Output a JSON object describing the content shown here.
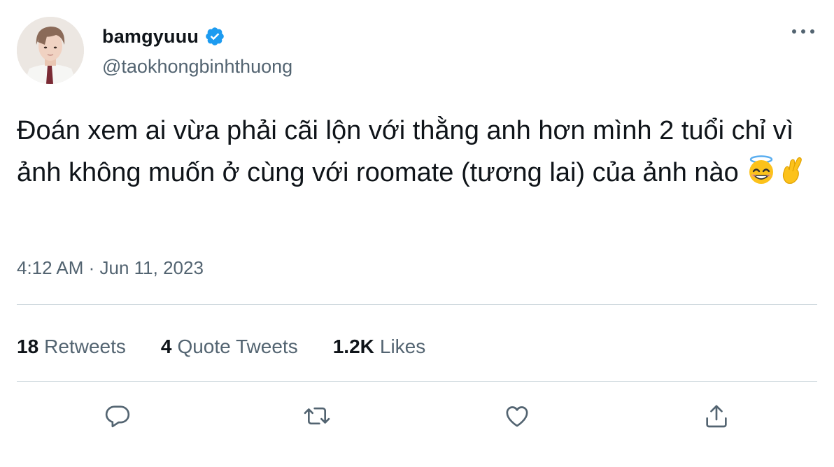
{
  "user": {
    "display_name": "bamgyuuu",
    "handle": "@taokhongbinhthuong",
    "verified": true
  },
  "tweet": {
    "text": "Đoán xem ai vừa phải cãi lộn với thằng anh hơn mình 2 tuổi chỉ vì ảnh không muốn ở cùng với roomate (tương lai) của ảnh nào",
    "emojis": [
      "smiling-face-with-halo",
      "crossed-fingers"
    ],
    "timestamp": "4:12 AM · Jun 11, 2023"
  },
  "stats": {
    "retweets_count": "18",
    "retweets_label": "Retweets",
    "quotes_count": "4",
    "quotes_label": "Quote Tweets",
    "likes_count": "1.2K",
    "likes_label": "Likes"
  },
  "colors": {
    "text_primary": "#0f1419",
    "text_secondary": "#536471",
    "verified_blue": "#1d9bf0",
    "divider": "#cfd9de"
  },
  "icons": {
    "more": "more-horizontal-icon",
    "reply": "reply-icon",
    "retweet": "retweet-icon",
    "like": "heart-icon",
    "share": "share-icon",
    "verified": "verified-badge-icon"
  }
}
